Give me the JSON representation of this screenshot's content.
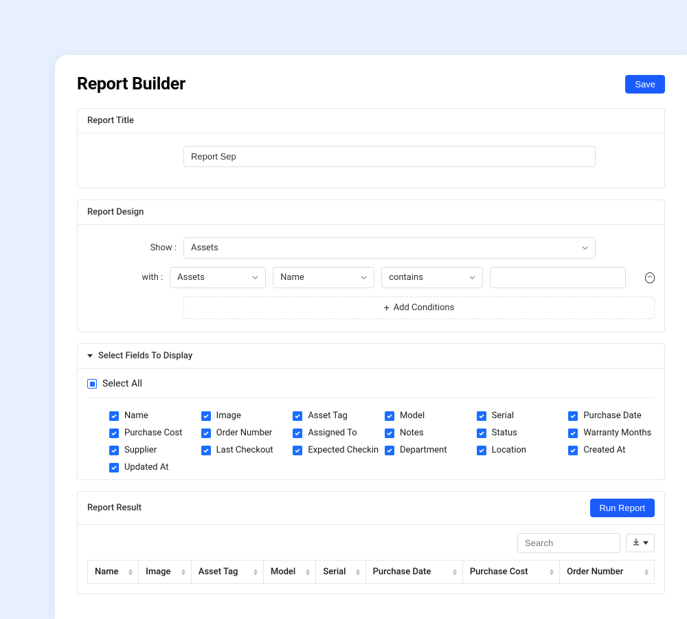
{
  "page": {
    "title": "Report Builder",
    "save_label": "Save"
  },
  "report_title": {
    "section_label": "Report Title",
    "value": "Report Sep"
  },
  "design": {
    "section_label": "Report Design",
    "show_label": "Show :",
    "show_value": "Assets",
    "with_label": "with :",
    "with_entity": "Assets",
    "with_field": "Name",
    "with_op": "contains",
    "with_value": "",
    "add_conditions": "Add Conditions"
  },
  "fields": {
    "section_label": "Select Fields To Display",
    "select_all": "Select All",
    "items": [
      "Name",
      "Image",
      "Asset Tag",
      "Model",
      "Serial",
      "Purchase Date",
      "Purchase Cost",
      "Order Number",
      "Assigned To",
      "Notes",
      "Status",
      "Warranty Months",
      "Supplier",
      "Last Checkout",
      "Expected Checkin",
      "Department",
      "Location",
      "Created At",
      "Updated At"
    ]
  },
  "result": {
    "section_label": "Report Result",
    "run_label": "Run Report",
    "search_placeholder": "Search",
    "columns": [
      "Name",
      "Image",
      "Asset Tag",
      "Model",
      "Serial",
      "Purchase Date",
      "Purchase Cost",
      "Order Number"
    ]
  }
}
